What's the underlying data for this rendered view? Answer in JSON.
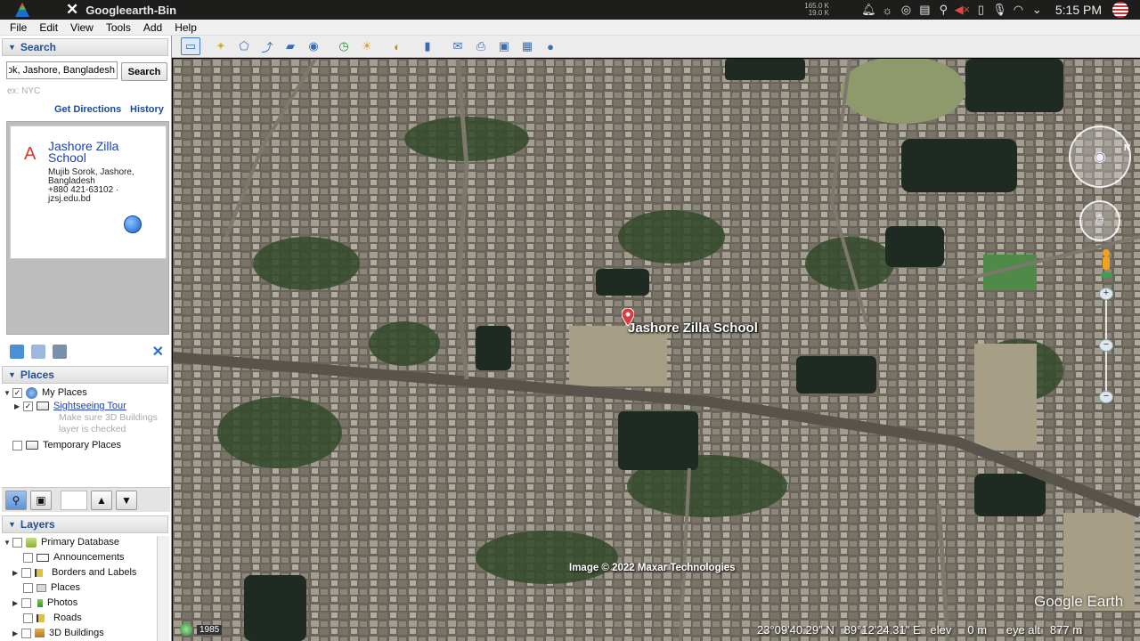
{
  "window": {
    "title": "Googleearth-Bin"
  },
  "system_tray": {
    "net_up": "165.0 K",
    "net_down": "19.0 K",
    "clock": "5:15 PM",
    "icons": [
      "bell-icon",
      "brightness-icon",
      "vpn-icon",
      "clipboard-icon",
      "location-icon",
      "volume-muted-icon",
      "phone-icon",
      "microphone-icon",
      "wifi-icon",
      "chevron-down-icon",
      "flag-avatar-icon"
    ]
  },
  "menu": {
    "items": [
      "File",
      "Edit",
      "View",
      "Tools",
      "Add",
      "Help"
    ]
  },
  "search": {
    "header": "Search",
    "query": "Mujib Sorok, Jashore, Bangladesh",
    "button": "Search",
    "hint": "ex: NYC",
    "get_directions": "Get Directions",
    "history": "History",
    "result": {
      "letter": "A",
      "title": "Jashore Zilla School",
      "address": "Mujib Sorok, Jashore, Bangladesh",
      "phone": "+880 421-63102 ·",
      "website": "jzsj.edu.bd"
    }
  },
  "places": {
    "header": "Places",
    "items": [
      {
        "label": "My Places",
        "checked": true
      },
      {
        "label": "Sightseeing Tour",
        "checked": true,
        "note": "Make sure 3D Buildings layer is checked"
      },
      {
        "label": "Temporary Places",
        "checked": false
      }
    ]
  },
  "layers": {
    "header": "Layers",
    "items": [
      {
        "label": "Primary Database"
      },
      {
        "label": "Announcements"
      },
      {
        "label": "Borders and Labels"
      },
      {
        "label": "Places"
      },
      {
        "label": "Photos"
      },
      {
        "label": "Roads"
      },
      {
        "label": "3D Buildings"
      }
    ]
  },
  "map": {
    "placemark_label": "Jashore Zilla School",
    "copyright": "Image © 2022 Maxar Technologies",
    "logo": "Google Earth",
    "history_year": "1985",
    "lat": "23°09'40.29\" N",
    "lon": "89°12'24.31\" E",
    "elev_label": "elev",
    "elev_value": "0 m",
    "eye_alt_label": "eye alt",
    "eye_alt_value": "877 m"
  }
}
